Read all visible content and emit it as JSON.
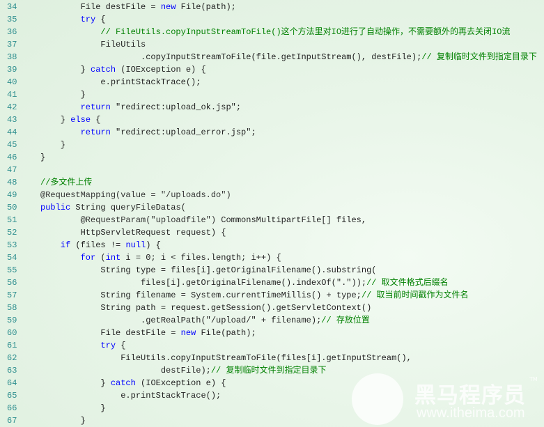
{
  "colors": {
    "keyword": "#0000ff",
    "comment": "#008000",
    "line_number": "#2f8f8f",
    "text": "#222222"
  },
  "lines": [
    {
      "n": "34",
      "seg": [
        [
          "p",
          "        File destFile = "
        ],
        [
          "kw",
          "new"
        ],
        [
          "p",
          " File(path);"
        ]
      ]
    },
    {
      "n": "35",
      "seg": [
        [
          "kw",
          "        try"
        ],
        [
          "p",
          " {"
        ]
      ]
    },
    {
      "n": "36",
      "seg": [
        [
          "cm",
          "            // FileUtils.copyInputStreamToFile()这个方法里对IO进行了自动操作，不需要额外的再去关闭IO流"
        ]
      ]
    },
    {
      "n": "37",
      "seg": [
        [
          "p",
          "            FileUtils"
        ]
      ]
    },
    {
      "n": "38",
      "seg": [
        [
          "p",
          "                    .copyInputStreamToFile(file.getInputStream(), destFile);"
        ],
        [
          "cm",
          "// 复制临时文件到指定目录下"
        ]
      ]
    },
    {
      "n": "39",
      "seg": [
        [
          "p",
          "        } "
        ],
        [
          "kw",
          "catch"
        ],
        [
          "p",
          " (IOException e) {"
        ]
      ]
    },
    {
      "n": "40",
      "seg": [
        [
          "p",
          "            e.printStackTrace();"
        ]
      ]
    },
    {
      "n": "41",
      "seg": [
        [
          "p",
          "        }"
        ]
      ]
    },
    {
      "n": "42",
      "seg": [
        [
          "kw",
          "        return"
        ],
        [
          "st",
          " \"redirect:upload_ok.jsp\""
        ],
        [
          "p",
          ";"
        ]
      ]
    },
    {
      "n": "43",
      "seg": [
        [
          "p",
          "    } "
        ],
        [
          "kw",
          "else"
        ],
        [
          "p",
          " {"
        ]
      ]
    },
    {
      "n": "44",
      "seg": [
        [
          "kw",
          "        return"
        ],
        [
          "st",
          " \"redirect:upload_error.jsp\""
        ],
        [
          "p",
          ";"
        ]
      ]
    },
    {
      "n": "45",
      "seg": [
        [
          "p",
          "    }"
        ]
      ]
    },
    {
      "n": "46",
      "seg": [
        [
          "p",
          "}"
        ]
      ]
    },
    {
      "n": "47",
      "seg": []
    },
    {
      "n": "48",
      "seg": [
        [
          "cm",
          "//多文件上传"
        ]
      ]
    },
    {
      "n": "49",
      "seg": [
        [
          "an",
          "@RequestMapping(value = \"/uploads.do\")"
        ]
      ]
    },
    {
      "n": "50",
      "seg": [
        [
          "kw",
          "public"
        ],
        [
          "p",
          " String queryFileDatas("
        ]
      ]
    },
    {
      "n": "51",
      "seg": [
        [
          "an",
          "        @RequestParam(\"uploadfile\")"
        ],
        [
          "p",
          " CommonsMultipartFile[] files,"
        ]
      ]
    },
    {
      "n": "52",
      "seg": [
        [
          "p",
          "        HttpServletRequest request) {"
        ]
      ]
    },
    {
      "n": "53",
      "seg": [
        [
          "kw",
          "    if"
        ],
        [
          "p",
          " (files != "
        ],
        [
          "kw",
          "null"
        ],
        [
          "p",
          ") {"
        ]
      ]
    },
    {
      "n": "54",
      "seg": [
        [
          "kw",
          "        for"
        ],
        [
          "p",
          " ("
        ],
        [
          "kw",
          "int"
        ],
        [
          "p",
          " i = 0; i < files.length; i++) {"
        ]
      ]
    },
    {
      "n": "55",
      "seg": [
        [
          "p",
          "            String type = files[i].getOriginalFilename().substring("
        ]
      ]
    },
    {
      "n": "56",
      "seg": [
        [
          "p",
          "                    files[i].getOriginalFilename().indexOf(\".\"));"
        ],
        [
          "cm",
          "// 取文件格式后缀名"
        ]
      ]
    },
    {
      "n": "57",
      "seg": [
        [
          "p",
          "            String filename = System.currentTimeMillis() + type;"
        ],
        [
          "cm",
          "// 取当前时间戳作为文件名"
        ]
      ]
    },
    {
      "n": "58",
      "seg": [
        [
          "p",
          "            String path = request.getSession().getServletContext()"
        ]
      ]
    },
    {
      "n": "59",
      "seg": [
        [
          "p",
          "                    .getRealPath(\"/upload/\" + filename);"
        ],
        [
          "cm",
          "// 存放位置"
        ]
      ]
    },
    {
      "n": "60",
      "seg": [
        [
          "p",
          "            File destFile = "
        ],
        [
          "kw",
          "new"
        ],
        [
          "p",
          " File(path);"
        ]
      ]
    },
    {
      "n": "61",
      "seg": [
        [
          "kw",
          "            try"
        ],
        [
          "p",
          " {"
        ]
      ]
    },
    {
      "n": "62",
      "seg": [
        [
          "p",
          "                FileUtils.copyInputStreamToFile(files[i].getInputStream(),"
        ]
      ]
    },
    {
      "n": "63",
      "seg": [
        [
          "p",
          "                        destFile);"
        ],
        [
          "cm",
          "// 复制临时文件到指定目录下"
        ]
      ]
    },
    {
      "n": "64",
      "seg": [
        [
          "p",
          "            } "
        ],
        [
          "kw",
          "catch"
        ],
        [
          "p",
          " (IOException e) {"
        ]
      ]
    },
    {
      "n": "65",
      "seg": [
        [
          "p",
          "                e.printStackTrace();"
        ]
      ]
    },
    {
      "n": "66",
      "seg": [
        [
          "p",
          "            }"
        ]
      ]
    },
    {
      "n": "67",
      "seg": [
        [
          "p",
          "        }"
        ]
      ]
    }
  ],
  "watermark": {
    "brand": "黑马程序员",
    "trademark": "TM",
    "url": "www.itheima.com"
  }
}
